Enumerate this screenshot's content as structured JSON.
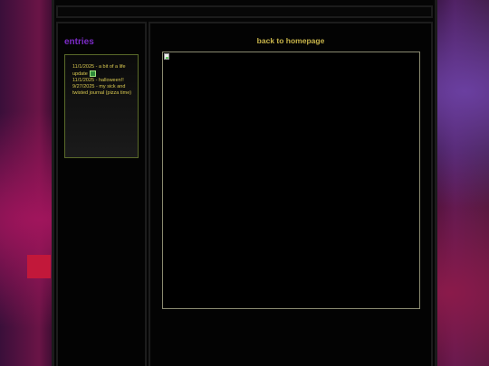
{
  "sidebar": {
    "title": "entries",
    "entries": [
      {
        "text": "11/1/2025 - a bit of a life update"
      },
      {
        "text": "11/1/2025 - halloween!!"
      },
      {
        "text": "9/27/2025 - my sick and twisted journal (pizza time)"
      }
    ]
  },
  "main": {
    "home_link": "back to homepage",
    "image_icon": "broken-image-icon"
  },
  "colors": {
    "title_purple": "#7b2bc6",
    "link_gold": "#c8b44a",
    "entry_text": "#d8c850"
  }
}
